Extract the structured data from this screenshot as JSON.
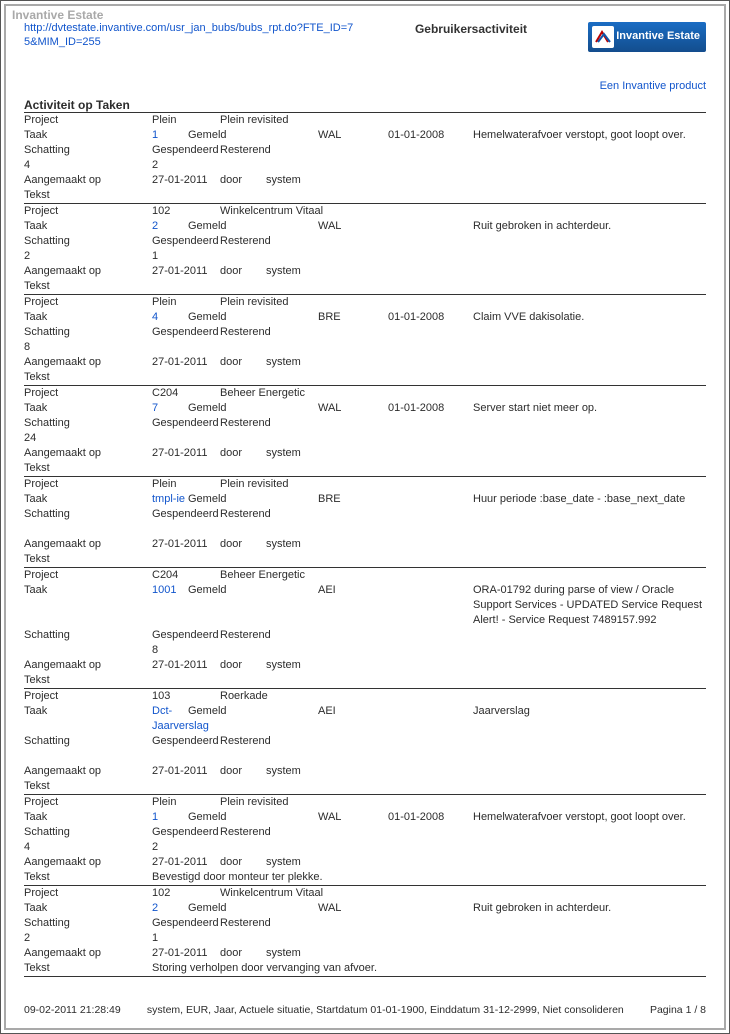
{
  "brand_top": "Invantive Estate",
  "header": {
    "url": "http://dvtestate.invantive.com/usr_jan_bubs/bubs_rpt.do?FTE_ID=75&MIM_ID=255",
    "title": "Gebruikersactiviteit",
    "logo_text": "Invantive Estate",
    "sub_brand": "Een Invantive product"
  },
  "section_title": "Activiteit op Taken",
  "labels": {
    "project": "Project",
    "task": "Taak",
    "estimate": "Schatting",
    "spent": "Gespendeerd",
    "remaining": "Resterend",
    "created": "Aangemaakt op",
    "by": "door",
    "text": "Tekst"
  },
  "blocks": [
    {
      "project_code": "Plein",
      "project_name": "Plein revisited",
      "task_id": "1",
      "status": "Gemeld",
      "code": "WAL",
      "date": "01-01-2008",
      "desc": "Hemelwaterafvoer verstopt, goot loopt over.",
      "est": "4",
      "spent": "2",
      "created": "27-01-2011",
      "by": "system",
      "text": ""
    },
    {
      "project_code": "102",
      "project_name": "Winkelcentrum Vitaal",
      "task_id": "2",
      "status": "Gemeld",
      "code": "WAL",
      "date": "",
      "desc": "Ruit gebroken in achterdeur.",
      "est": "2",
      "spent": "1",
      "created": "27-01-2011",
      "by": "system",
      "text": ""
    },
    {
      "project_code": "Plein",
      "project_name": "Plein revisited",
      "task_id": "4",
      "status": "Gemeld",
      "code": "BRE",
      "date": "01-01-2008",
      "desc": "Claim VVE dakisolatie.",
      "est": "8",
      "spent": "",
      "created": "27-01-2011",
      "by": "system",
      "text": ""
    },
    {
      "project_code": "C204",
      "project_name": "Beheer Energetic",
      "task_id": "7",
      "status": "Gemeld",
      "code": "WAL",
      "date": "01-01-2008",
      "desc": "Server start niet meer op.",
      "est": "24",
      "spent": "",
      "created": "27-01-2011",
      "by": "system",
      "text": ""
    },
    {
      "project_code": "Plein",
      "project_name": "Plein revisited",
      "task_id": "tmpl-ie",
      "status": "Gemeld",
      "code": "BRE",
      "date": "",
      "desc": "Huur periode :base_date - :base_next_date",
      "est": "",
      "spent": "",
      "created": "27-01-2011",
      "by": "system",
      "text": ""
    },
    {
      "project_code": "C204",
      "project_name": "Beheer Energetic",
      "task_id": "1001",
      "status": "Gemeld",
      "code": "AEI",
      "date": "",
      "desc": "ORA-01792 during parse of view / Oracle Support Services - UPDATED Service Request Alert! - Service Request 7489157.992",
      "est": "",
      "spent": "8",
      "created": "27-01-2011",
      "by": "system",
      "text": ""
    },
    {
      "project_code": "103",
      "project_name": "Roerkade",
      "task_id": "Dct-Jaarverslag",
      "status": "Gemeld",
      "code": "AEI",
      "date": "",
      "desc": "Jaarverslag",
      "est": "",
      "spent": "",
      "created": "27-01-2011",
      "by": "system",
      "text": ""
    },
    {
      "project_code": "Plein",
      "project_name": "Plein revisited",
      "task_id": "1",
      "status": "Gemeld",
      "code": "WAL",
      "date": "01-01-2008",
      "desc": "Hemelwaterafvoer verstopt, goot loopt over.",
      "est": "4",
      "spent": "2",
      "created": "27-01-2011",
      "by": "system",
      "text": "Bevestigd door monteur ter plekke."
    },
    {
      "project_code": "102",
      "project_name": "Winkelcentrum Vitaal",
      "task_id": "2",
      "status": "Gemeld",
      "code": "WAL",
      "date": "",
      "desc": "Ruit gebroken in achterdeur.",
      "est": "2",
      "spent": "1",
      "created": "27-01-2011",
      "by": "system",
      "text": "Storing verholpen door vervanging van afvoer."
    }
  ],
  "footer": {
    "timestamp": "09-02-2011 21:28:49",
    "center": "system, EUR, Jaar, Actuele situatie, Startdatum 01-01-1900, Einddatum 31-12-2999, Niet consolideren",
    "page": "Pagina 1 / 8"
  }
}
